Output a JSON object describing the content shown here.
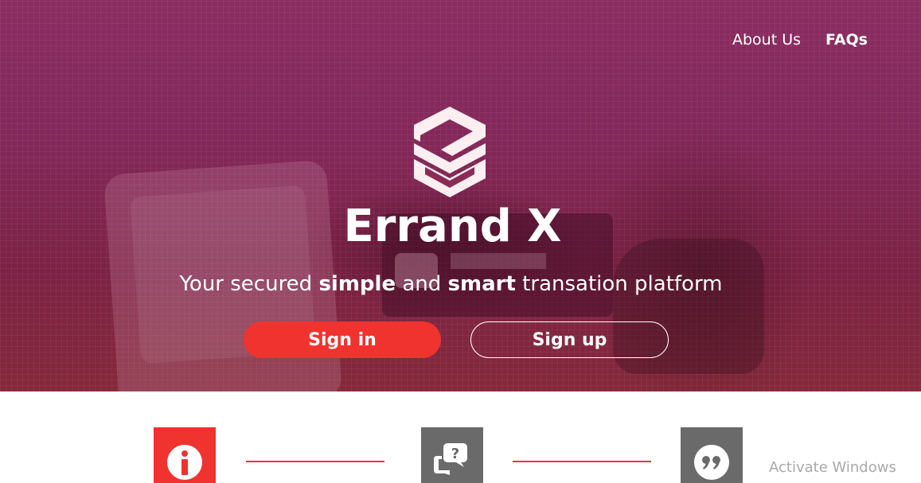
{
  "nav": {
    "about_label": "About Us",
    "faqs_label": "FAQs"
  },
  "hero": {
    "brand_name": "Errand X",
    "tagline": {
      "part1": "Your secured ",
      "bold1": "simple",
      "part2": " and ",
      "bold2": "smart",
      "part3": " transation platform"
    },
    "signin_label": "Sign in",
    "signup_label": "Sign up"
  },
  "features": [
    {
      "icon": "info-icon"
    },
    {
      "icon": "question-chat-icon"
    },
    {
      "icon": "quote-icon"
    }
  ],
  "watermark": "Activate Windows",
  "colors": {
    "accent": "#f0332e",
    "hero_overlay": "#82285a",
    "feature_icon_grey": "#6a6a6a"
  }
}
